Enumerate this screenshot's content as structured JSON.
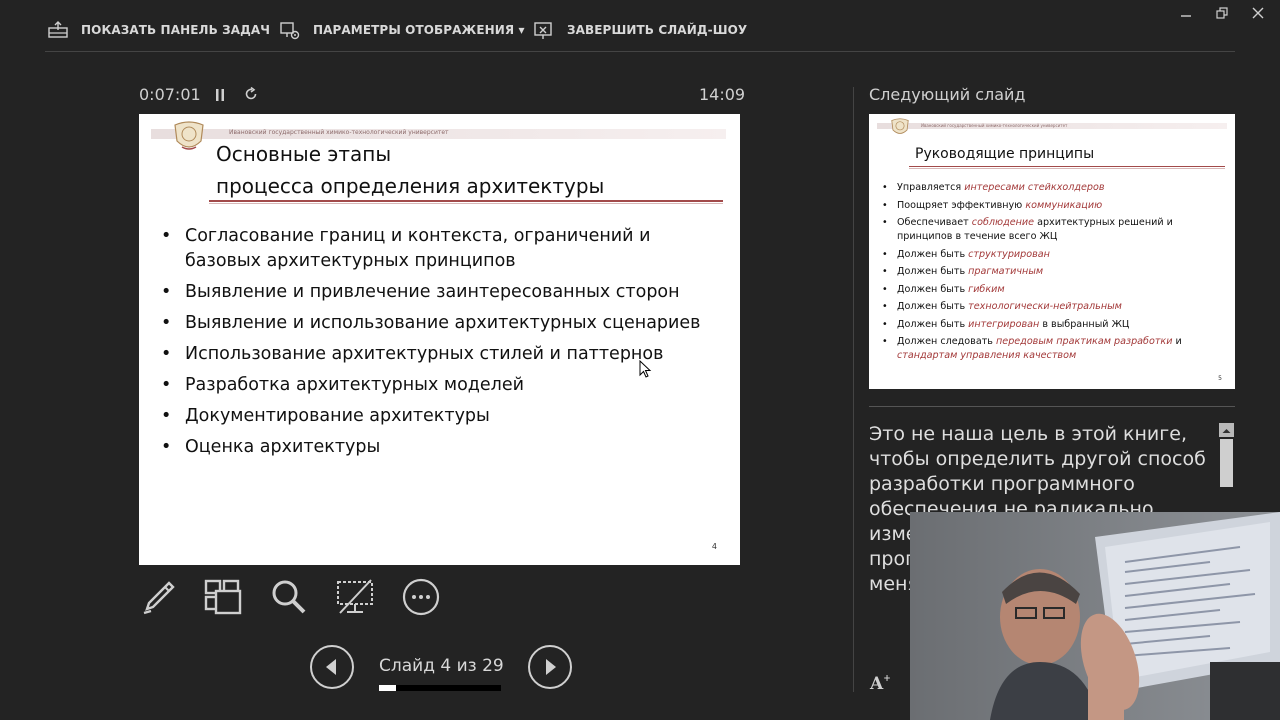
{
  "toolbar": {
    "taskbar_label": "ПОКАЗАТЬ ПАНЕЛЬ ЗАДАЧ",
    "display_label": "ПАРАМЕТРЫ ОТОБРАЖЕНИЯ ▾",
    "end_label": "ЗАВЕРШИТЬ СЛАЙД-ШОУ"
  },
  "timer": {
    "elapsed": "0:07:01",
    "clock": "14:09"
  },
  "current_slide": {
    "header_text": "Ивановский государственный химико-технологический университет",
    "title_line1": "Основные этапы",
    "title_line2": "процесса определения архитектуры",
    "bullets": [
      "Согласование границ и контекста, ограничений и базовых архитектурных принципов",
      "Выявление и привлечение заинтересованных сторон",
      "Выявление и использование архитектурных сценариев",
      "Использование архитектурных стилей и паттернов",
      "Разработка архитектурных моделей",
      "Документирование архитектуры",
      "Оценка архитектуры"
    ],
    "page_number": "4"
  },
  "navigation": {
    "slide_counter": "Слайд 4 из 29",
    "progress_fraction": 0.138
  },
  "next_slide": {
    "label": "Следующий слайд",
    "header_text": "Ивановский государственный химико-технологический университет",
    "title": "Руководящие принципы",
    "bullets": [
      {
        "pre": "Управляется ",
        "em": "интересами стейкхолдеров",
        "post": ""
      },
      {
        "pre": "Поощряет эффективную ",
        "em": "коммуникацию",
        "post": ""
      },
      {
        "pre": "Обеспечивает ",
        "em": "соблюдение",
        "post": " архитектурных решений и принципов в течение всего ЖЦ"
      },
      {
        "pre": "Должен быть ",
        "em": "структурирован",
        "post": ""
      },
      {
        "pre": "Должен быть ",
        "em": "прагматичным",
        "post": ""
      },
      {
        "pre": "Должен быть ",
        "em": "гибким",
        "post": ""
      },
      {
        "pre": "Должен быть ",
        "em": "технологически-нейтральным",
        "post": ""
      },
      {
        "pre": "Должен быть ",
        "em": "интегрирован",
        "post": " в выбранный ЖЦ"
      },
      {
        "pre": "Должен следовать ",
        "em": "передовым практикам разработки",
        "post": " и ",
        "em2": "стандартам управления качеством"
      }
    ],
    "page_number": "5"
  },
  "notes": {
    "text": "Это не наша цель в этой книге, чтобы определить другой способ разработки программного обеспечения не радикально изменить жизненный цикл программного обеспечения, не меняя разработки обеспечения"
  },
  "colors": {
    "background": "#232323",
    "accent_red": "#a24a4a",
    "emphasis_red": "#a33a3a"
  },
  "icons": {
    "taskbar": "taskbar-icon",
    "display": "display-settings-icon",
    "end": "end-slideshow-icon",
    "pen": "pen-icon",
    "grid": "all-slides-icon",
    "zoom": "zoom-icon",
    "screen": "black-screen-icon",
    "more": "more-options-icon"
  }
}
